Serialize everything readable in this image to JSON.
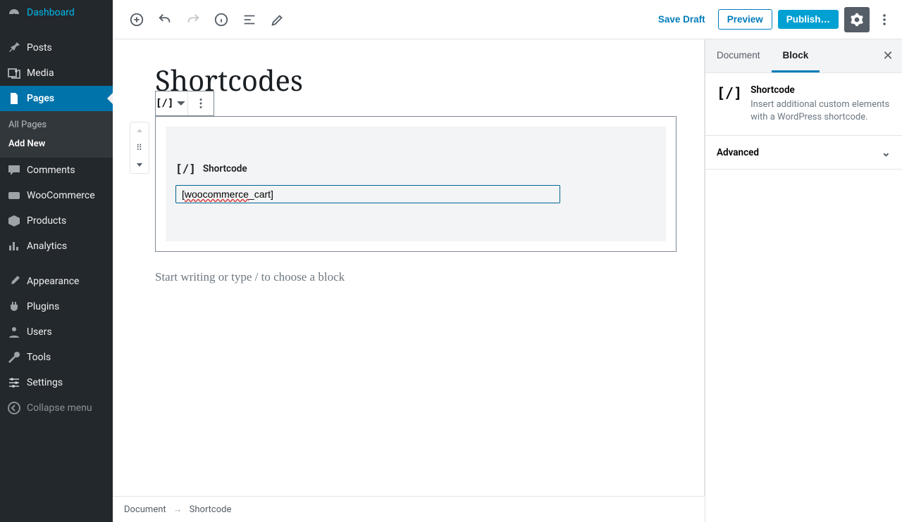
{
  "sidebar": {
    "items": [
      {
        "label": "Dashboard"
      },
      {
        "label": "Posts"
      },
      {
        "label": "Media"
      },
      {
        "label": "Pages"
      },
      {
        "label": "Comments"
      },
      {
        "label": "WooCommerce"
      },
      {
        "label": "Products"
      },
      {
        "label": "Analytics"
      },
      {
        "label": "Appearance"
      },
      {
        "label": "Plugins"
      },
      {
        "label": "Users"
      },
      {
        "label": "Tools"
      },
      {
        "label": "Settings"
      }
    ],
    "pages_sub": {
      "all": "All Pages",
      "add": "Add New"
    },
    "collapse": "Collapse menu"
  },
  "topbar": {
    "save_draft": "Save Draft",
    "preview": "Preview",
    "publish": "Publish…"
  },
  "editor": {
    "page_title": "Shortcodes",
    "block": {
      "label": "Shortcode",
      "value_pre": "[",
      "value_mis": "woocommerce",
      "value_post": "_cart]"
    },
    "appender": "Start writing or type / to choose a block"
  },
  "breadcrumb": {
    "root": "Document",
    "leaf": "Shortcode"
  },
  "inspector": {
    "tabs": {
      "document": "Document",
      "block": "Block"
    },
    "block_card": {
      "title": "Shortcode",
      "desc": "Insert additional custom elements with a WordPress shortcode."
    },
    "advanced": "Advanced"
  }
}
